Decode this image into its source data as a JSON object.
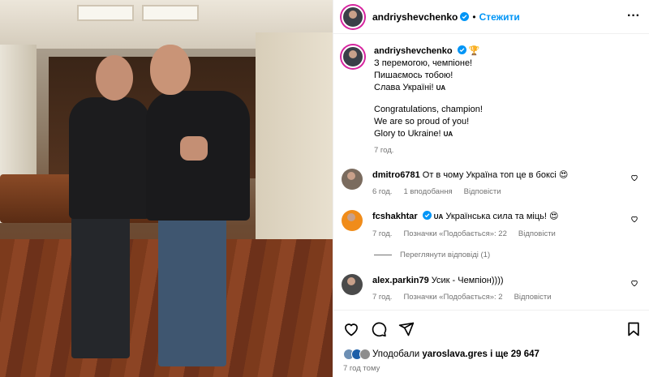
{
  "header": {
    "username": "andriyshevchenko",
    "dot": "•",
    "follow_label": "Стежити",
    "more_icon": "more-options-icon"
  },
  "caption": {
    "username": "andriyshevchenko",
    "line1": "З перемогою, чемпіоне!",
    "line2": "Пишаємось тобою!",
    "line3": "Слава Україні!",
    "flag1": "UA",
    "line4": "Congratulations, champion!",
    "line5": "We are so proud of you!",
    "line6": "Glory to Ukraine!",
    "flag2": "UA",
    "time": "7 год."
  },
  "comments": [
    {
      "username": "dmitro6781",
      "text": "От в чому Україна топ це в боксі 😍",
      "time": "6 год.",
      "likes": "1 вподобання",
      "reply": "Відповісти"
    },
    {
      "username": "fcshakhtar",
      "flag": "UA",
      "text": "Українська сила та міць! 😍",
      "time": "7 год.",
      "likes": "Позначки «Подобається»: 22",
      "reply": "Відповісти",
      "view_replies": "Переглянути відповіді (1)"
    },
    {
      "username": "alex.parkin79",
      "text": "Усик - Чемпіон))))",
      "time": "7 год.",
      "likes": "Позначки «Подобається»: 2",
      "reply": "Відповісти"
    }
  ],
  "actions": {
    "liked_by_prefix": "Уподобали",
    "liked_by_user": "yaroslava.gres",
    "liked_by_suffix": "і ще 29 647",
    "time_ago": "7 год тому"
  },
  "colors": {
    "accent": "#0095f6",
    "muted": "#737373",
    "border": "#efefef"
  }
}
